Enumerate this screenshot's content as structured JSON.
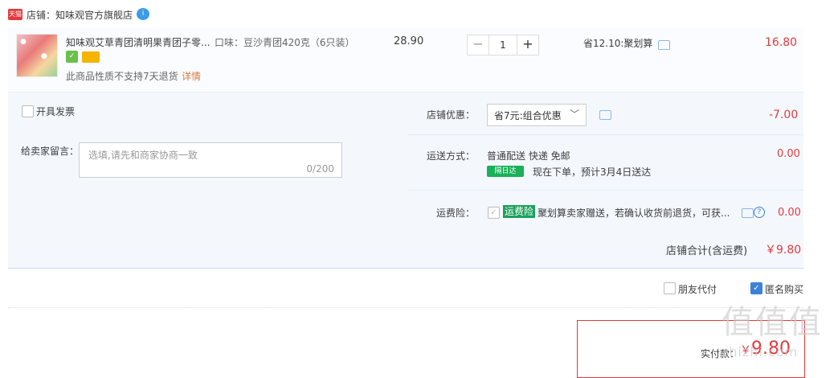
{
  "shop": {
    "tmall_label": "天猫",
    "label": "店铺：",
    "name": "知味观官方旗舰店",
    "chat_label": "i"
  },
  "item": {
    "title": "知味观艾草青团清明果青团子零...",
    "sku": "口味：豆沙青团420克（6只装）",
    "notice": "此商品性质不支持7天退货",
    "details_link": "详情",
    "price": "28.90",
    "quantity": "1",
    "minus": "−",
    "plus": "+",
    "promo": "省12.10:聚划算",
    "subtotal": "16.80"
  },
  "invoice": {
    "label": "开具发票"
  },
  "memo": {
    "label": "给卖家留言：",
    "placeholder": "选填,请先和商家协商一致",
    "counter": "0/200"
  },
  "discount": {
    "label": "店铺优惠：",
    "selected": "省7元:组合优惠",
    "amount": "-7.00"
  },
  "shipping": {
    "label": "运送方式：",
    "method": "普通配送 快递 免邮",
    "badge": "隔日达",
    "eta": "现在下单，预计3月4日送达",
    "amount": "0.00"
  },
  "insurance": {
    "label": "运费险：",
    "badge": "运费险",
    "desc": "聚划算卖家赠送，若确认收货前退货，可获...",
    "help": "?",
    "amount": "0.00"
  },
  "total": {
    "label": "店铺合计(含运费)",
    "currency": "￥",
    "amount": "9.80"
  },
  "options": {
    "friend_pay": "朋友代付",
    "anonymous": "匿名购买",
    "anonymous_checked": true
  },
  "pay": {
    "label": "实付款：",
    "currency": "￥",
    "amount": "9.80"
  },
  "watermark": {
    "main": "值值值",
    "sub": "zhizhi.com"
  },
  "colors": {
    "accent_red": "#e4393c",
    "panel_bg": "#f4f8fd",
    "link_blue": "#3c82d9"
  }
}
